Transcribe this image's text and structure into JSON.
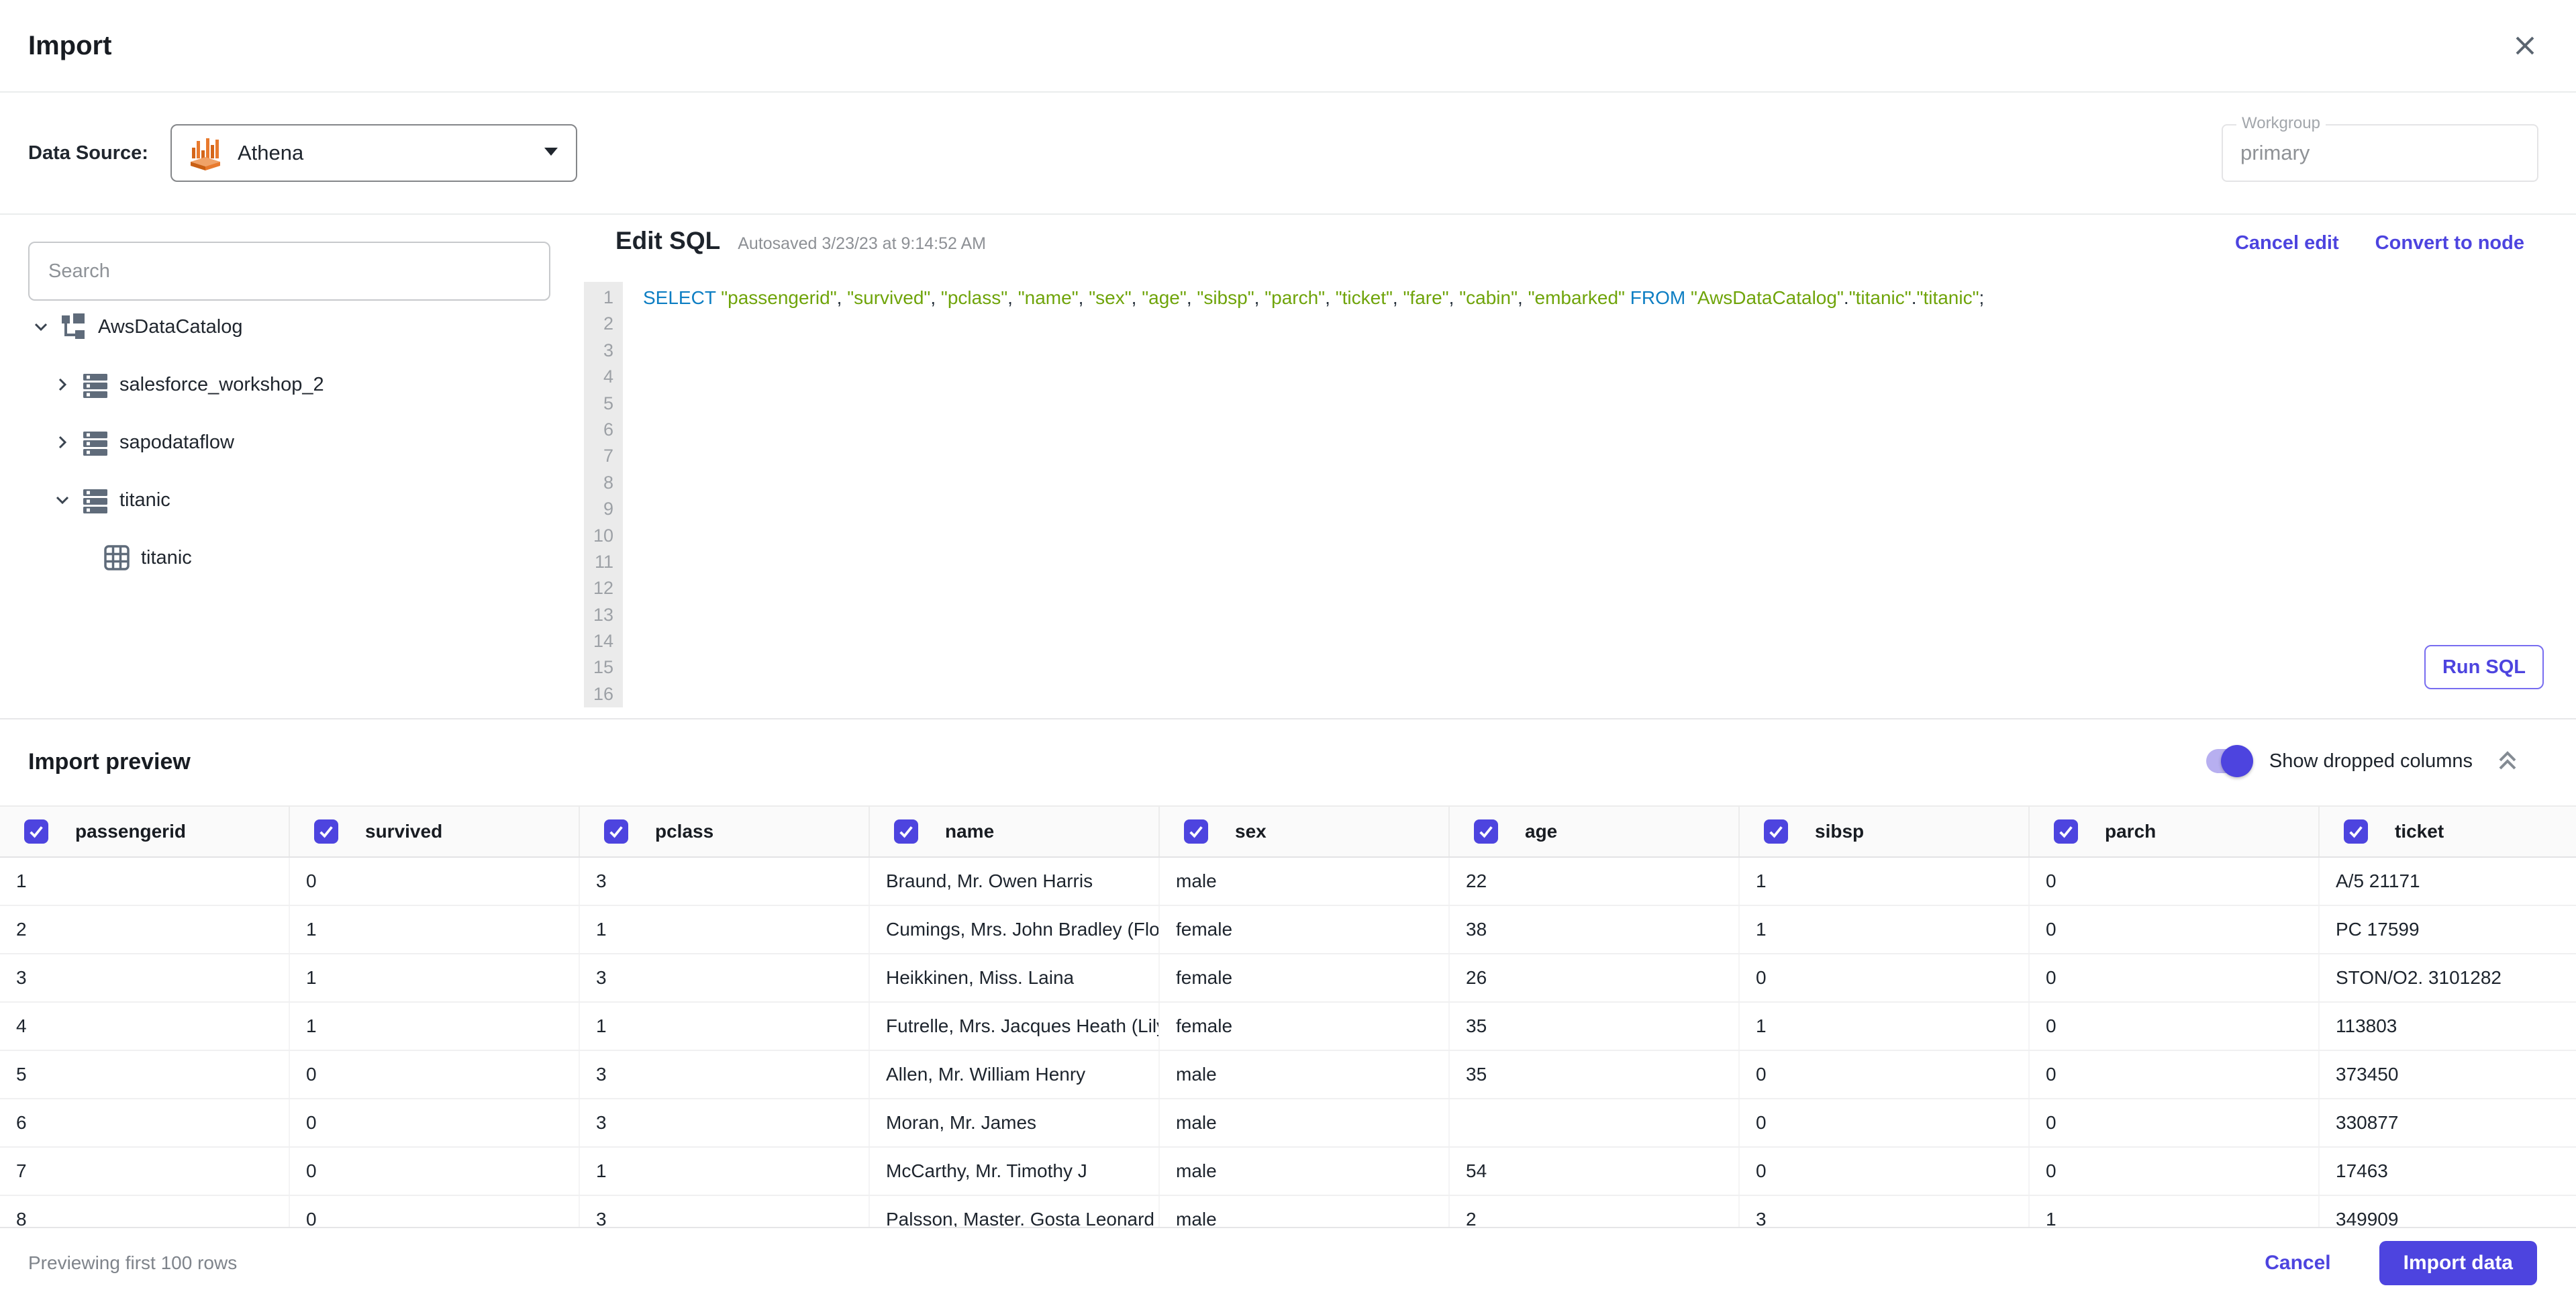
{
  "colors": {
    "accent": "#4d44df",
    "sql_keyword": "#0d7ec3",
    "sql_string": "#6fa40a"
  },
  "header": {
    "title": "Import"
  },
  "datasource": {
    "label": "Data Source:",
    "selected": "Athena",
    "icon": "athena-logo",
    "workgroup_label": "Workgroup",
    "workgroup_placeholder": "primary"
  },
  "sidebar": {
    "search_placeholder": "Search",
    "tree": [
      {
        "label": "AwsDataCatalog",
        "icon": "catalog",
        "chevron": "down",
        "level": 0
      },
      {
        "label": "salesforce_workshop_2",
        "icon": "database",
        "chevron": "right",
        "level": 1
      },
      {
        "label": "sapodataflow",
        "icon": "database",
        "chevron": "right",
        "level": 1
      },
      {
        "label": "titanic",
        "icon": "database",
        "chevron": "down",
        "level": 1
      },
      {
        "label": "titanic",
        "icon": "table",
        "chevron": "none",
        "level": 2
      }
    ]
  },
  "editor": {
    "title": "Edit SQL",
    "autosave": "Autosaved 3/23/23 at 9:14:52 AM",
    "cancel_edit": "Cancel edit",
    "convert_to_node": "Convert to node",
    "run_sql": "Run SQL",
    "line_count": 16,
    "sql_tokens": [
      {
        "t": "SELECT",
        "c": "kw"
      },
      {
        "t": " ",
        "c": "pl"
      },
      {
        "t": "\"passengerid\"",
        "c": "str"
      },
      {
        "t": ", ",
        "c": "pl"
      },
      {
        "t": "\"survived\"",
        "c": "str"
      },
      {
        "t": ", ",
        "c": "pl"
      },
      {
        "t": "\"pclass\"",
        "c": "str"
      },
      {
        "t": ", ",
        "c": "pl"
      },
      {
        "t": "\"name\"",
        "c": "str"
      },
      {
        "t": ", ",
        "c": "pl"
      },
      {
        "t": "\"sex\"",
        "c": "str"
      },
      {
        "t": ", ",
        "c": "pl"
      },
      {
        "t": "\"age\"",
        "c": "str"
      },
      {
        "t": ", ",
        "c": "pl"
      },
      {
        "t": "\"sibsp\"",
        "c": "str"
      },
      {
        "t": ", ",
        "c": "pl"
      },
      {
        "t": "\"parch\"",
        "c": "str"
      },
      {
        "t": ", ",
        "c": "pl"
      },
      {
        "t": "\"ticket\"",
        "c": "str"
      },
      {
        "t": ", ",
        "c": "pl"
      },
      {
        "t": "\"fare\"",
        "c": "str"
      },
      {
        "t": ", ",
        "c": "pl"
      },
      {
        "t": "\"cabin\"",
        "c": "str"
      },
      {
        "t": ", ",
        "c": "pl"
      },
      {
        "t": "\"embarked\"",
        "c": "str"
      },
      {
        "t": " ",
        "c": "pl"
      },
      {
        "t": "FROM",
        "c": "kw"
      },
      {
        "t": " ",
        "c": "pl"
      },
      {
        "t": "\"AwsDataCatalog\"",
        "c": "str"
      },
      {
        "t": ".",
        "c": "pl"
      },
      {
        "t": "\"titanic\"",
        "c": "str"
      },
      {
        "t": ".",
        "c": "pl"
      },
      {
        "t": "\"titanic\"",
        "c": "str"
      },
      {
        "t": ";",
        "c": "pl"
      }
    ]
  },
  "preview": {
    "title": "Import preview",
    "toggle_label": "Show dropped columns",
    "toggle_on": true,
    "columns": [
      {
        "label": "passengerid",
        "checked": true
      },
      {
        "label": "survived",
        "checked": true
      },
      {
        "label": "pclass",
        "checked": true
      },
      {
        "label": "name",
        "checked": true
      },
      {
        "label": "sex",
        "checked": true
      },
      {
        "label": "age",
        "checked": true
      },
      {
        "label": "sibsp",
        "checked": true
      },
      {
        "label": "parch",
        "checked": true
      },
      {
        "label": "ticket",
        "checked": true
      }
    ],
    "rows": [
      [
        "1",
        "0",
        "3",
        "Braund, Mr. Owen Harris",
        "male",
        "22",
        "1",
        "0",
        "A/5 21171"
      ],
      [
        "2",
        "1",
        "1",
        "Cumings, Mrs. John Bradley (Florenc",
        "female",
        "38",
        "1",
        "0",
        "PC 17599"
      ],
      [
        "3",
        "1",
        "3",
        "Heikkinen, Miss. Laina",
        "female",
        "26",
        "0",
        "0",
        "STON/O2. 3101282"
      ],
      [
        "4",
        "1",
        "1",
        "Futrelle, Mrs. Jacques Heath (Lily Ma",
        "female",
        "35",
        "1",
        "0",
        "113803"
      ],
      [
        "5",
        "0",
        "3",
        "Allen, Mr. William Henry",
        "male",
        "35",
        "0",
        "0",
        "373450"
      ],
      [
        "6",
        "0",
        "3",
        "Moran, Mr. James",
        "male",
        "",
        "0",
        "0",
        "330877"
      ],
      [
        "7",
        "0",
        "1",
        "McCarthy, Mr. Timothy J",
        "male",
        "54",
        "0",
        "0",
        "17463"
      ],
      [
        "8",
        "0",
        "3",
        "Palsson, Master. Gosta Leonard",
        "male",
        "2",
        "3",
        "1",
        "349909"
      ]
    ]
  },
  "footer": {
    "note": "Previewing first 100 rows",
    "cancel": "Cancel",
    "import": "Import data"
  }
}
